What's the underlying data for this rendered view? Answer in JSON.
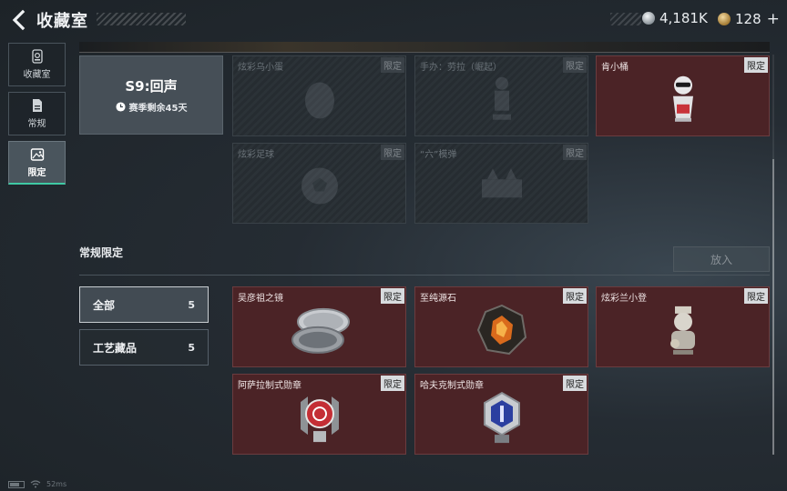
{
  "header": {
    "title": "收藏室",
    "currency_silver": "4,181K",
    "currency_gold": "128",
    "plus_label": "+"
  },
  "nav": [
    {
      "label": "收藏室",
      "icon": "collection-icon",
      "active": false
    },
    {
      "label": "常规",
      "icon": "document-icon",
      "active": false
    },
    {
      "label": "限定",
      "icon": "image-icon",
      "active": true
    }
  ],
  "season": {
    "name": "S9:回声",
    "remaining": "赛季剩余45天"
  },
  "season_items": [
    {
      "name": "炫彩乌小蛋",
      "tag": "限定",
      "owned": false
    },
    {
      "name": "手办：劳拉（崛起）",
      "tag": "限定",
      "owned": false
    },
    {
      "name": "肯小桶",
      "tag": "限定",
      "owned": true
    },
    {
      "name": "炫彩足球",
      "tag": "限定",
      "owned": false
    },
    {
      "name": "“六”模弹",
      "tag": "限定",
      "owned": false
    }
  ],
  "section": {
    "title": "常规限定",
    "place_button": "放入"
  },
  "filters": [
    {
      "label": "全部",
      "count": "5",
      "active": true
    },
    {
      "label": "工艺藏品",
      "count": "5",
      "active": false
    }
  ],
  "regular_items": [
    {
      "name": "吴彦祖之镜",
      "tag": "限定",
      "owned": true
    },
    {
      "name": "至纯源石",
      "tag": "限定",
      "owned": true
    },
    {
      "name": "炫彩兰小登",
      "tag": "限定",
      "owned": true
    },
    {
      "name": "阿萨拉制式勋章",
      "tag": "限定",
      "owned": true
    },
    {
      "name": "哈夫克制式勋章",
      "tag": "限定",
      "owned": true
    }
  ],
  "status": {
    "ping": "52ms"
  },
  "colors": {
    "accent": "#3fc9a4",
    "owned_card": "#4b2326",
    "locked_card": "#2b3237"
  }
}
